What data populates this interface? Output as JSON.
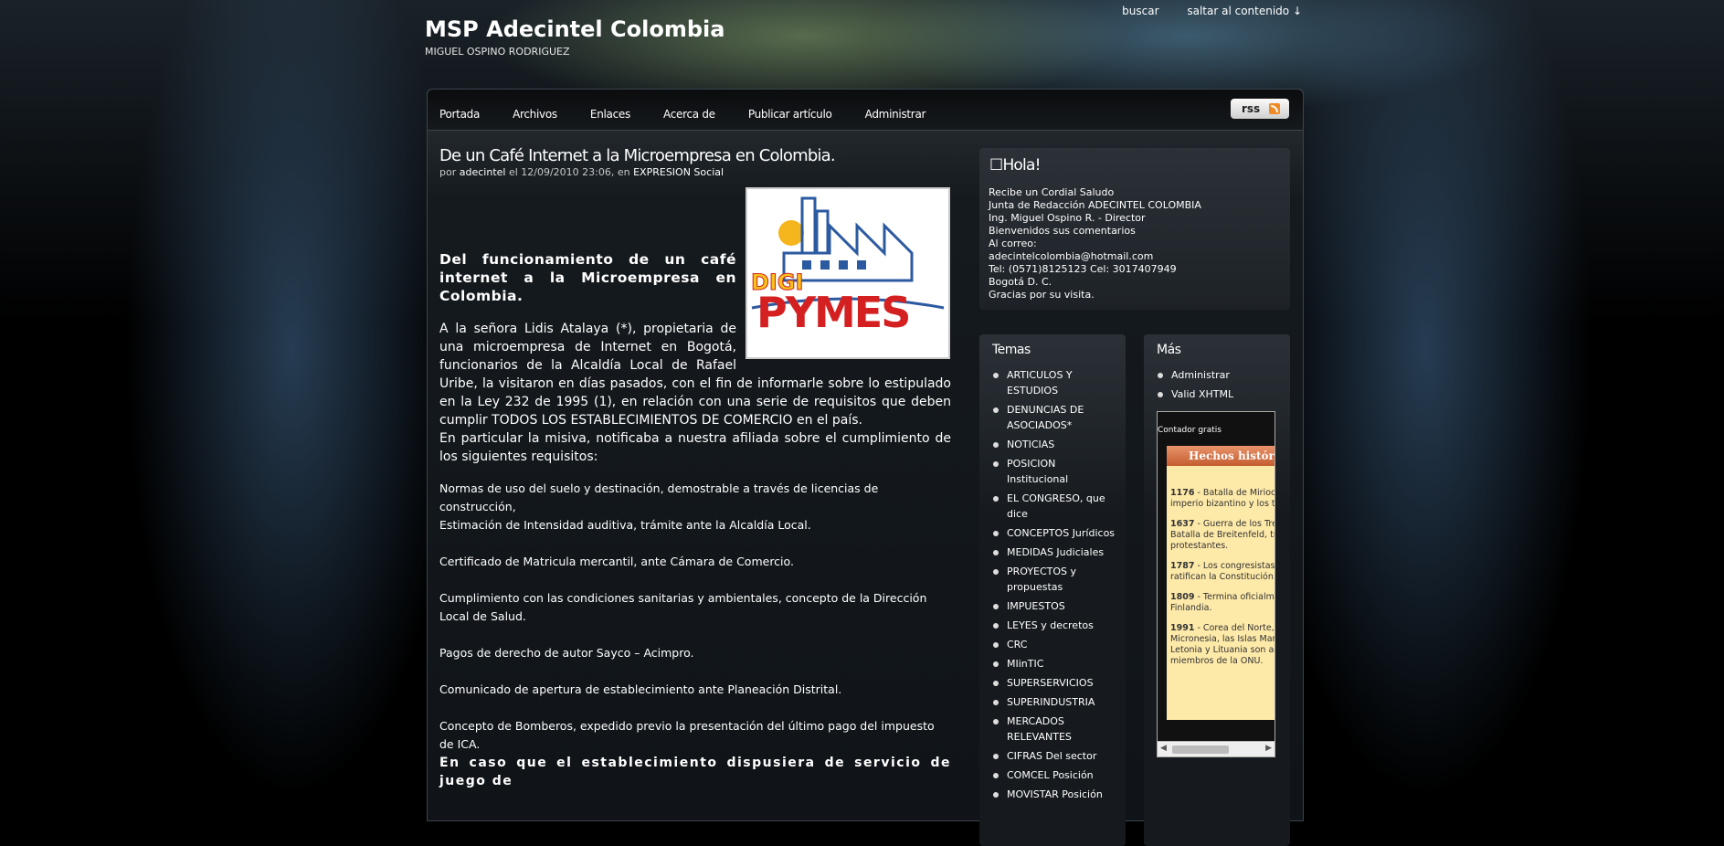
{
  "header": {
    "site_title": "MSP Adecintel Colombia",
    "site_description": "MIGUEL OSPINO RODRIGUEZ",
    "search_link": "buscar",
    "skip_link": "saltar al contenido ↓"
  },
  "nav": {
    "items": [
      "Portada",
      "Archivos",
      "Enlaces",
      "Acerca de",
      "Publicar artículo",
      "Administrar"
    ],
    "rss_label": "rss",
    "rss_icon": "rss-feed-icon"
  },
  "post": {
    "title": "De un Café Internet a la Microempresa en Colombia.",
    "meta_prefix": "por",
    "author": "adecintel",
    "meta_mid": "el 12/09/2010 23:06, en",
    "category": "EXPRESION Social",
    "image_text_top": "DIGI",
    "image_text_bottom": "PYMES",
    "heading": "Del funcionamiento de un café internet a la Microempresa en Colombia.",
    "para1": "A la señora Lidis Atalaya (*), propietaria de una microempresa de Internet en  Bogotá, funcionarios de la Alcaldía Local de Rafael Uribe,  la visitaron en días pasados, con el fin de informarle sobre lo estipulado en la Ley 232 de 1995 (1), en relación con una serie de requisitos que deben cumplir TODOS LOS ESTABLECIMIENTOS  DE COMERCIO en el país.",
    "para2": "En particular la misiva, notificaba a nuestra afiliada sobre el cumplimiento de los siguientes requisitos:",
    "requirements": [
      "Normas de uso del suelo y destinación, demostrable a través de licencias de construcción,",
      "Estimación de Intensidad auditiva, trámite ante la  Alcaldía Local.",
      "Certificado de Matricula mercantil, ante Cámara de Comercio.",
      "Cumplimiento con las condiciones sanitarias y ambientales, concepto de la Dirección Local de Salud.",
      "Pagos de derecho de autor Sayco – Acimpro.",
      "Comunicado de apertura de establecimiento ante Planeación Distrital.",
      "Concepto de Bomberos, expedido previo la presentación del último pago del impuesto de ICA."
    ],
    "cut_line": "En caso que el establecimiento dispusiera de servicio de juego de"
  },
  "sidebar": {
    "hola_title": "☐Hola!",
    "hola_lines": [
      "Recibe un Cordial Saludo",
      "Junta de Redacción ADECINTEL COLOMBIA",
      "Ing. Miguel Ospino R. - Director",
      "Bienvenidos sus comentarios",
      "Al correo:",
      "adecintelcolombia@hotmail.com",
      "Tel: (0571)8125123 Cel: 3017407949",
      "Bogotá D. C.",
      "Gracias por su visita."
    ],
    "temas_title": "Temas",
    "temas": [
      "ARTICULOS Y ESTUDIOS",
      "DENUNCIAS DE ASOCIADOS*",
      "NOTICIAS",
      "POSICION Institucional",
      "EL CONGRESO, que dice",
      "CONCEPTOS Jurídicos",
      "MEDIDAS Judiciales",
      "PROYECTOS y propuestas",
      "IMPUESTOS",
      "LEYES y decretos",
      "CRC",
      "MIinTIC",
      "SUPERSERVICIOS",
      "SUPERINDUSTRIA",
      "MERCADOS RELEVANTES",
      "CIFRAS Del sector",
      "COMCEL Posición",
      "MOVISTAR Posición"
    ],
    "mas_title": "Más",
    "mas": [
      "Administrar",
      "Valid XHTML"
    ],
    "counter_label": "Contador gratis",
    "hist_title": "Hechos históricos",
    "hist_items": [
      {
        "year": "1176",
        "text": "- Batalla de Miriocéfalo entre el imperio bizantino y los turcos selyúcidas."
      },
      {
        "year": "1637",
        "text": "- Guerra de los Treinta Años: Batalla de Breitenfeld, triunfan los protestantes."
      },
      {
        "year": "1787",
        "text": "- Los congresistas estadounidenses ratifican la Constitución."
      },
      {
        "year": "1809",
        "text": "- Termina oficialmente la Guerra de Finlandia."
      },
      {
        "year": "1991",
        "text": "- Corea del Norte, Corea del Sur, Micronesia, las Islas Marshall, Estonia, Letonia y Lituania son admitidos como miembros de la ONU."
      }
    ]
  }
}
